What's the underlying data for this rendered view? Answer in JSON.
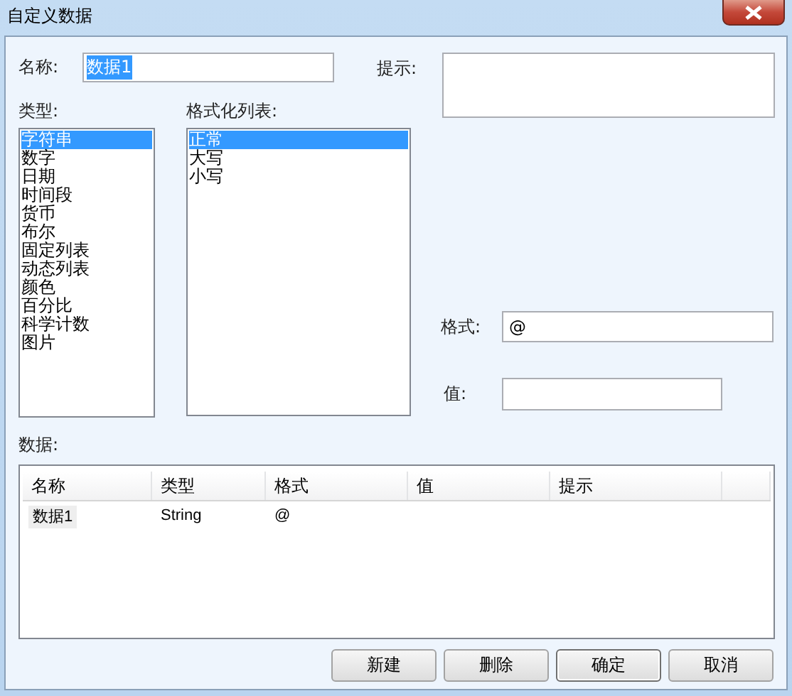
{
  "window": {
    "title": "自定义数据"
  },
  "name_field": {
    "label": "名称:",
    "value": "数据1",
    "text_selected": true
  },
  "hint_field": {
    "label": "提示:"
  },
  "type_list": {
    "label": "类型:",
    "items": [
      {
        "label": "字符串",
        "selected": true
      },
      {
        "label": "数字",
        "selected": false
      },
      {
        "label": "日期",
        "selected": false
      },
      {
        "label": "时间段",
        "selected": false
      },
      {
        "label": "货币",
        "selected": false
      },
      {
        "label": "布尔",
        "selected": false
      },
      {
        "label": "固定列表",
        "selected": false
      },
      {
        "label": "动态列表",
        "selected": false
      },
      {
        "label": "颜色",
        "selected": false
      },
      {
        "label": "百分比",
        "selected": false
      },
      {
        "label": "科学计数",
        "selected": false
      },
      {
        "label": "图片",
        "selected": false
      }
    ]
  },
  "format_list": {
    "label": "格式化列表:",
    "items": [
      {
        "label": "正常",
        "selected": true
      },
      {
        "label": "大写",
        "selected": false
      },
      {
        "label": "小写",
        "selected": false
      }
    ]
  },
  "format_field": {
    "label": "格式:",
    "value": "@"
  },
  "value_field": {
    "label": "值:"
  },
  "data_table": {
    "label": "数据:",
    "columns": [
      "名称",
      "类型",
      "格式",
      "值",
      "提示"
    ],
    "rows": [
      {
        "cells": [
          "数据1",
          "String",
          "@",
          "",
          ""
        ],
        "selected": true
      }
    ]
  },
  "buttons": [
    "新建",
    "删除",
    "确定",
    "取消"
  ]
}
